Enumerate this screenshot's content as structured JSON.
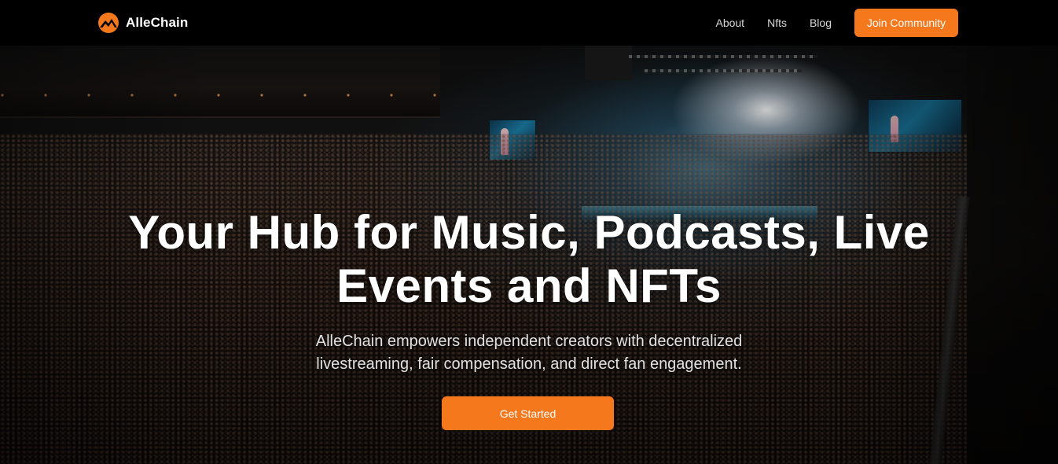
{
  "nav": {
    "brand_name": "AlleChain",
    "logo_icon": "mountain-sun-logo-icon",
    "links": [
      "About",
      "Nfts",
      "Blog"
    ],
    "join_label": "Join Community"
  },
  "hero": {
    "title_line1": "Your Hub for Music, Podcasts, Live",
    "title_line2": "Events and NFTs",
    "subtitle_line1": "AlleChain empowers independent creators with decentralized",
    "subtitle_line2": "livestreaming, fair compensation, and direct fan engagement.",
    "cta_label": "Get Started",
    "background": "concert-arena-crowd-photo"
  },
  "colors": {
    "accent": "#f5781c",
    "nav_background": "#000000",
    "text_primary": "#ffffff"
  }
}
